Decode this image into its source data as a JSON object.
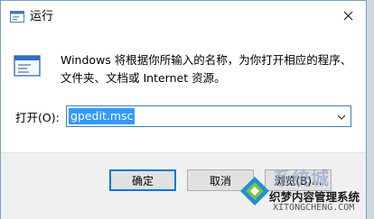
{
  "window": {
    "title": "运行"
  },
  "content": {
    "description_line1": "Windows 将根据你所输入的名称，为你打开相应的程序、",
    "description_line2": "文件夹、文档或 Internet 资源。",
    "open_label": "打开(O):",
    "open_value": "gpedit.msc"
  },
  "footer": {
    "ok_label": "确定",
    "cancel_label": "取消",
    "browse_label": "浏览(B)..."
  },
  "watermark": {
    "brand": "系统城",
    "name": "织梦内容管理系统",
    "url": "XITONGCHENG.COM"
  },
  "colors": {
    "accent": "#0078d7",
    "selection": "#3399ff"
  },
  "icons": [
    "run-app-icon",
    "close-icon",
    "run-dialog-icon",
    "chevron-down-icon"
  ]
}
